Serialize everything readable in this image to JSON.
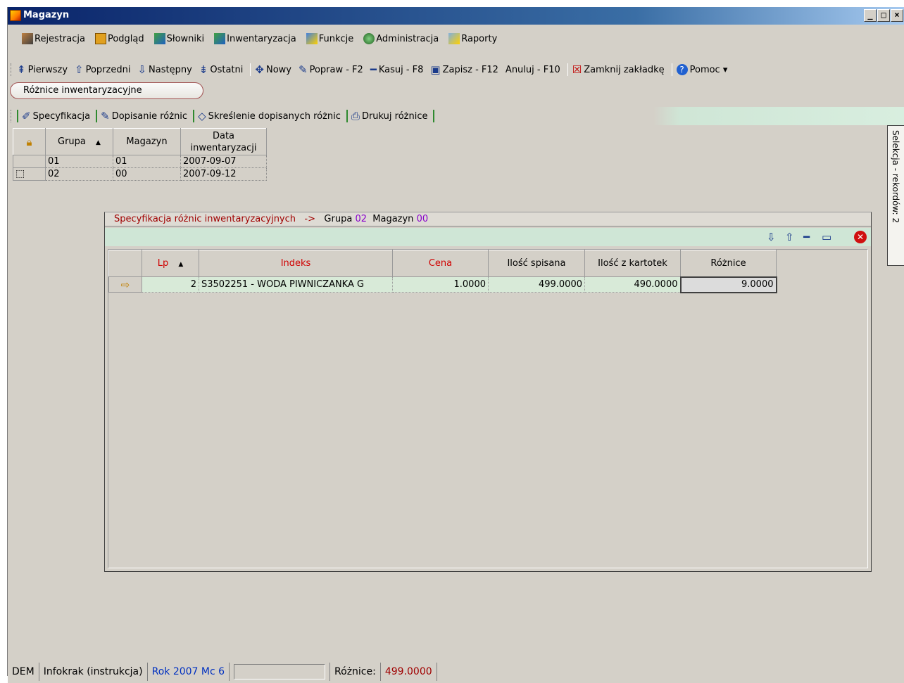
{
  "window": {
    "title": "Magazyn"
  },
  "menubar": [
    {
      "label": "Rejestracja",
      "icon": "pen-icon",
      "color": "#404040"
    },
    {
      "label": "Podgląd",
      "icon": "folder-icon",
      "color": "#d08000"
    },
    {
      "label": "Słowniki",
      "icon": "dictionary-icon",
      "color": "#208020"
    },
    {
      "label": "Inwentaryzacja",
      "icon": "inventory-icon",
      "color": "#208020"
    },
    {
      "label": "Funkcje",
      "icon": "functions-icon",
      "color": "#2060c0"
    },
    {
      "label": "Administracja",
      "icon": "administration-icon",
      "color": "#40a040"
    },
    {
      "label": "Raporty",
      "icon": "reports-icon",
      "color": "#4080d0"
    }
  ],
  "toolbar": [
    {
      "label": "Pierwszy",
      "icon": "first-icon",
      "glyph": "⇞"
    },
    {
      "label": "Poprzedni",
      "icon": "previous-icon",
      "glyph": "⇧"
    },
    {
      "label": "Następny",
      "icon": "next-icon",
      "glyph": "⇩"
    },
    {
      "label": "Ostatni",
      "icon": "last-icon",
      "glyph": "⇟",
      "sep_after": true
    },
    {
      "label": "Nowy",
      "icon": "new-icon",
      "glyph": "✥"
    },
    {
      "label": "Popraw - F2",
      "icon": "edit-icon",
      "glyph": "✎"
    },
    {
      "label": "Kasuj - F8",
      "icon": "delete-icon",
      "glyph": "━"
    },
    {
      "label": "Zapisz - F12",
      "icon": "save-icon",
      "glyph": "▣"
    },
    {
      "label": "Anuluj - F10",
      "icon": "",
      "glyph": "",
      "sep_after": true
    },
    {
      "label": "Zamknij zakładkę",
      "icon": "close-tab-icon",
      "glyph": "☒",
      "sep_after": true
    },
    {
      "label": "Pomoc ▾",
      "icon": "help-icon",
      "glyph": "?"
    }
  ],
  "tab": {
    "label": "Różnice inwentaryzacyjne"
  },
  "subtoolbar": [
    {
      "label": "Specyfikacja",
      "icon": "specification-icon",
      "glyph": "✐"
    },
    {
      "label": "Dopisanie różnic",
      "icon": "add-differences-icon",
      "glyph": "✎"
    },
    {
      "label": "Skreślenie dopisanych różnic",
      "icon": "eraser-icon",
      "glyph": "◇"
    },
    {
      "label": "Drukuj różnice",
      "icon": "print-icon",
      "glyph": "⎙"
    }
  ],
  "top_grid": {
    "headers": {
      "grupa": "Grupa",
      "magazyn": "Magazyn",
      "data_line1": "Data",
      "data_line2": "inwentaryzacji"
    },
    "rows": [
      {
        "grupa": "01",
        "magazyn": "01",
        "data": "2007-09-07"
      },
      {
        "grupa": "02",
        "magazyn": "00",
        "data": "2007-09-12"
      }
    ]
  },
  "side_tab": {
    "label": "Selekcja - rekordów: 2"
  },
  "spec_panel": {
    "title": "Specyfikacja różnic inwentaryzacyjnych",
    "arrow": "->",
    "grupa_label": "Grupa",
    "grupa_value": "02",
    "magazyn_label": "Magazyn",
    "magazyn_value": "00",
    "headers": {
      "lp": "Lp",
      "indeks": "Indeks",
      "cena": "Cena",
      "ilosc_spisana": "Ilość spisana",
      "ilosc_kartotek": "Ilość z kartotek",
      "roznice": "Różnice"
    },
    "rows": [
      {
        "lp": "2",
        "indeks": "S3502251 - WODA PIWNICZANKA G",
        "cena": "1.0000",
        "ilosc_spisana": "499.0000",
        "ilosc_kartotek": "490.0000",
        "roznice": "9.0000"
      }
    ]
  },
  "statusbar": {
    "dem": "DEM",
    "user": "Infokrak (instrukcja)",
    "period": "Rok 2007  Mc 6",
    "diff_label": "Różnice:",
    "diff_value": "499.0000"
  }
}
